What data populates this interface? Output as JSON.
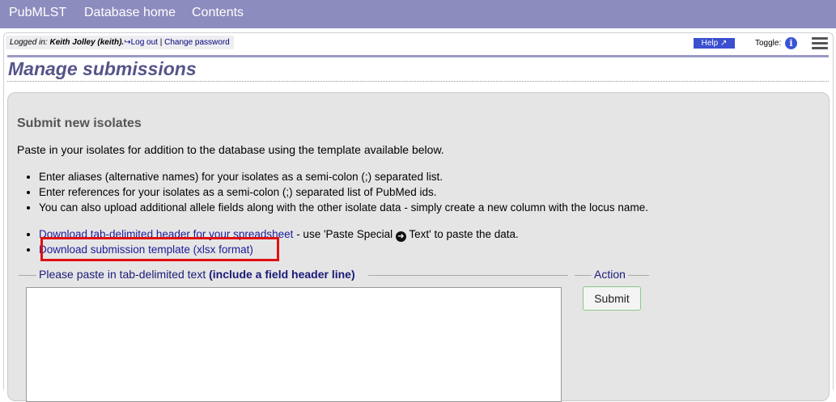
{
  "nav": {
    "brand": "PubMLST",
    "home": "Database home",
    "contents": "Contents"
  },
  "login": {
    "label": "Logged in:",
    "user": "Keith Jolley (keith).",
    "logout": "Log out",
    "separator": "|",
    "change_password": "Change password"
  },
  "help": {
    "label": "Help"
  },
  "toggle": {
    "label": "Toggle:"
  },
  "page": {
    "title": "Manage submissions"
  },
  "section": {
    "heading": "Submit new isolates",
    "intro": "Paste in your isolates for addition to the database using the template available below.",
    "notes": [
      "Enter aliases (alternative names) for your isolates as a semi-colon (;) separated list.",
      "Enter references for your isolates as a semi-colon (;) separated list of PubMed ids.",
      "You can also upload additional allele fields along with the other isolate data - simply create a new column with the locus name."
    ],
    "links": {
      "header_link": "Download tab-delimited header for your spreadsheet",
      "header_suffix_a": " - use 'Paste Special ",
      "header_suffix_b": " Text' to paste the data.",
      "template_link": "Download submission template (xlsx format)"
    },
    "paste_legend": "Please paste in tab-delimited text",
    "paste_legend_bold": "(include a field header line)",
    "action_legend": "Action",
    "submit_label": "Submit"
  },
  "colors": {
    "nav_bg": "#8c8cbf",
    "title": "#55558a",
    "highlight": "#e01010",
    "link": "#1a1a9a"
  }
}
